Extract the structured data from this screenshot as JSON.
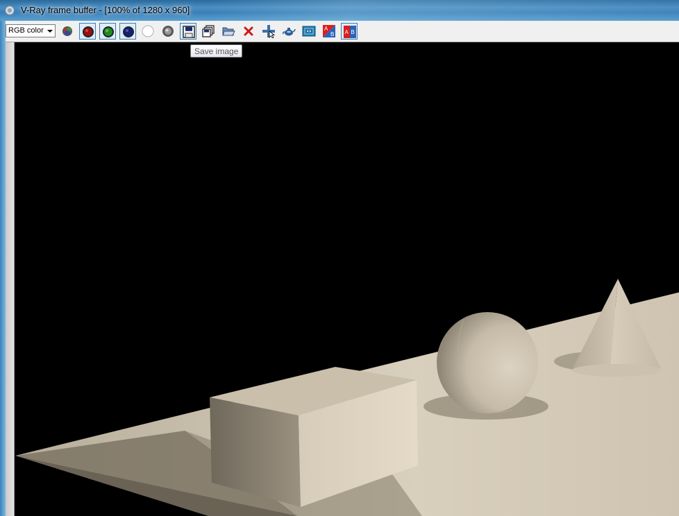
{
  "window": {
    "title": "V-Ray frame buffer - [100% of 1280 x 960]"
  },
  "toolbar": {
    "channel_select": {
      "value": "RGB color"
    },
    "buttons": [
      {
        "icon": "rgb-channels-icon"
      },
      {
        "icon": "red-channel-icon",
        "pressed": true
      },
      {
        "icon": "green-channel-icon",
        "pressed": true
      },
      {
        "icon": "blue-channel-icon",
        "pressed": true
      },
      {
        "icon": "alpha-channel-icon"
      },
      {
        "icon": "monochrome-icon"
      },
      {
        "icon": "save-image-icon",
        "pressed": true
      },
      {
        "icon": "save-all-icon"
      },
      {
        "icon": "load-image-icon"
      },
      {
        "icon": "clear-image-icon"
      },
      {
        "icon": "track-mouse-icon"
      },
      {
        "icon": "render-last-icon"
      },
      {
        "icon": "film-strip-icon"
      },
      {
        "icon": "ab-compare-horizontal-icon"
      },
      {
        "icon": "ab-compare-vertical-icon",
        "pressed": true
      }
    ]
  },
  "tooltip": {
    "text": "Save image"
  },
  "render": {
    "colors": {
      "background": "#000000",
      "floor": "#d3c8b6",
      "shadow": "#7c7363",
      "object": "#cdc3b1"
    }
  }
}
